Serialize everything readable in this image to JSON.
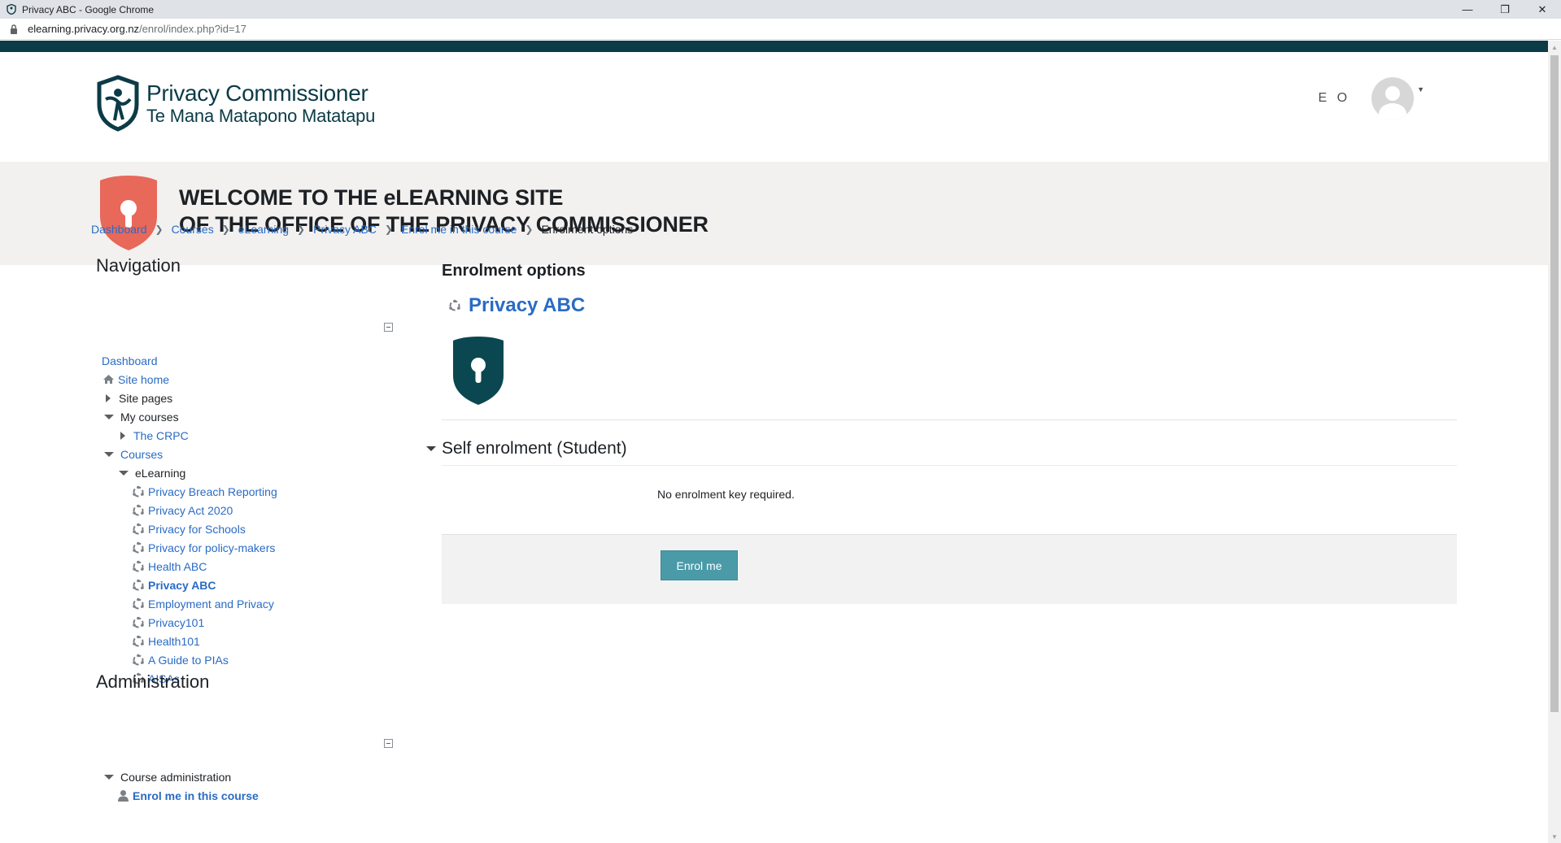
{
  "window": {
    "title": "Privacy ABC - Google Chrome",
    "url_domain": "elearning.privacy.org.nz",
    "url_path": "/enrol/index.php?id=17"
  },
  "header": {
    "logo_line1": "Privacy Commissioner",
    "logo_line2": "Te Mana Matapono Matatapu",
    "user_initials": "E O"
  },
  "banner": {
    "line1": "WELCOME TO THE eLEARNING SITE",
    "line2": "OF THE OFFICE OF THE PRIVACY COMMISSIONER"
  },
  "breadcrumb": [
    "Dashboard",
    "Courses",
    "eLearning",
    "Privacy ABC",
    "Enrol me in this course"
  ],
  "breadcrumb_current": "Enrolment options",
  "navigation": {
    "title": "Navigation",
    "dashboard": "Dashboard",
    "site_home": "Site home",
    "site_pages": "Site pages",
    "my_courses": "My courses",
    "the_crpc": "The CRPC",
    "courses": "Courses",
    "elearning": "eLearning",
    "course_list": [
      "Privacy Breach Reporting",
      "Privacy Act 2020",
      "Privacy for Schools",
      "Privacy for policy-makers",
      "Health ABC",
      "Privacy ABC",
      "Employment and Privacy",
      "Privacy101",
      "Health101",
      "A Guide to PIAs",
      "AISAs"
    ]
  },
  "administration": {
    "title": "Administration",
    "course_admin": "Course administration",
    "enrol_link": "Enrol me in this course"
  },
  "main": {
    "title": "Enrolment options",
    "course_name": "Privacy ABC",
    "self_enrol_title": "Self enrolment (Student)",
    "no_key_text": "No enrolment key required.",
    "enrol_button": "Enrol me"
  },
  "colors": {
    "top_stripe": "#0b3b47",
    "link": "#2a6bc5",
    "banner_shield": "#e8685a",
    "course_shield": "#0b4750",
    "button": "#4a9aa8"
  }
}
